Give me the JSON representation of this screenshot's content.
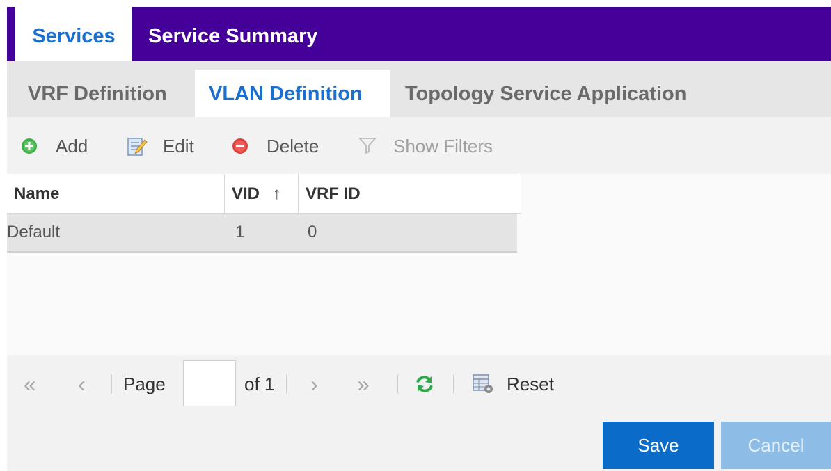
{
  "top_tabs": [
    {
      "label": "Services",
      "active": true
    },
    {
      "label": "Service Summary",
      "active": false
    }
  ],
  "sub_tabs": [
    {
      "label": "VRF Definition",
      "active": false
    },
    {
      "label": "VLAN Definition",
      "active": true
    },
    {
      "label": "Topology Service Application",
      "active": false
    }
  ],
  "toolbar": {
    "add_label": "Add",
    "edit_label": "Edit",
    "delete_label": "Delete",
    "filters_label": "Show Filters"
  },
  "grid": {
    "columns": [
      "Name",
      "VID",
      "VRF ID"
    ],
    "sort_indicator": "↑",
    "rows": [
      {
        "name": "Default",
        "vid": "1",
        "vrf_id": "0"
      }
    ]
  },
  "pager": {
    "first_icon": "«",
    "prev_icon": "‹",
    "page_label": "Page",
    "page_value": "",
    "of_label": "of 1",
    "next_icon": "›",
    "last_icon": "»",
    "reset_label": "Reset"
  },
  "footer": {
    "save_label": "Save",
    "cancel_label": "Cancel"
  },
  "colors": {
    "header_bg": "#440099",
    "active_tab_text": "#1a6fcf",
    "save_bg": "#0b6bc9",
    "cancel_bg": "#8dbde6",
    "refresh_icon": "#2fa84a"
  }
}
